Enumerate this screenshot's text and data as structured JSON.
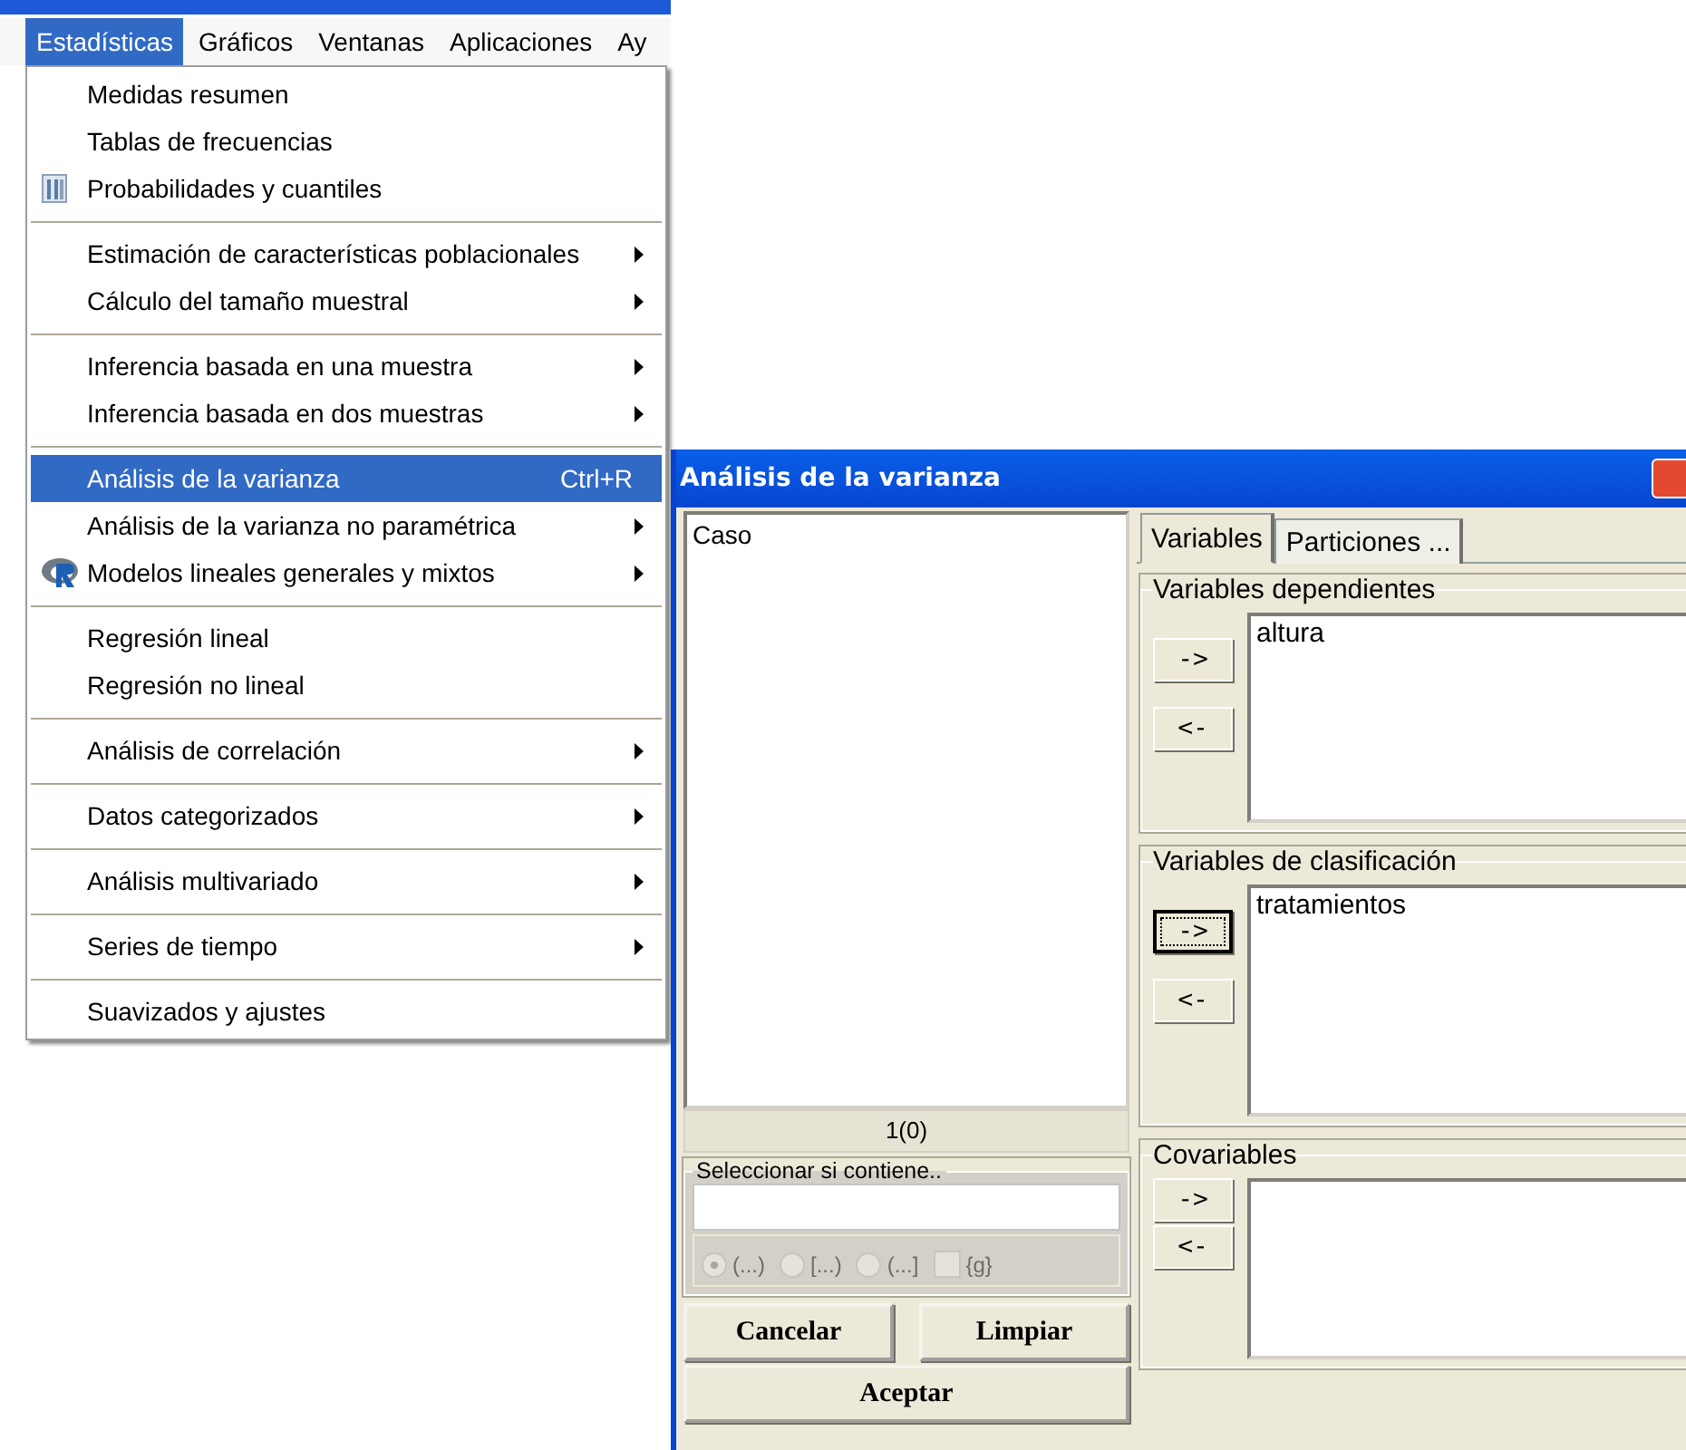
{
  "menubar": [
    {
      "label": "Estadísticas",
      "selected": true
    },
    {
      "label": "Gráficos",
      "selected": false
    },
    {
      "label": "Ventanas",
      "selected": false
    },
    {
      "label": "Aplicaciones",
      "selected": false
    },
    {
      "label": "Ay",
      "selected": false
    }
  ],
  "menu": {
    "groups": [
      [
        {
          "label": "Medidas resumen",
          "submenu": false,
          "selected": false
        },
        {
          "label": "Tablas de frecuencias",
          "submenu": false,
          "selected": false
        },
        {
          "label": "Probabilidades y cuantiles",
          "submenu": false,
          "selected": false,
          "kind": "tool"
        }
      ],
      [
        {
          "label": "Estimación de características poblacionales",
          "submenu": true,
          "selected": false
        },
        {
          "label": "Cálculo del tamaño muestral",
          "submenu": true,
          "selected": false
        }
      ],
      [
        {
          "label": "Inferencia basada en una muestra",
          "submenu": true,
          "selected": false
        },
        {
          "label": "Inferencia basada en dos muestras",
          "submenu": true,
          "selected": false
        }
      ],
      [
        {
          "label": "Análisis de la varianza",
          "submenu": false,
          "selected": true,
          "shortcut": "Ctrl+R"
        },
        {
          "label": "Análisis de la varianza no paramétrica",
          "submenu": true,
          "selected": false
        },
        {
          "label": "Modelos lineales generales y mixtos",
          "submenu": true,
          "selected": false,
          "kind": "script"
        }
      ],
      [
        {
          "label": "Regresión lineal",
          "submenu": false,
          "selected": false
        },
        {
          "label": "Regresión no lineal",
          "submenu": false,
          "selected": false
        }
      ],
      [
        {
          "label": "Análisis de correlación",
          "submenu": true,
          "selected": false
        }
      ],
      [
        {
          "label": "Datos categorizados",
          "submenu": true,
          "selected": false
        }
      ],
      [
        {
          "label": "Análisis multivariado",
          "submenu": true,
          "selected": false
        }
      ],
      [
        {
          "label": "Series de tiempo",
          "submenu": true,
          "selected": false
        }
      ],
      [
        {
          "label": "Suavizados y ajustes",
          "submenu": false,
          "selected": false
        }
      ]
    ]
  },
  "dialog": {
    "title": "Análisis de la varianza",
    "variables": [
      "Caso"
    ],
    "count": "1(0)",
    "filter": {
      "legend": "Seleccionar si contiene..",
      "disabled": true,
      "options": [
        {
          "kind": "radio",
          "label": "(...)",
          "selected": true
        },
        {
          "kind": "radio",
          "label": "[...)",
          "selected": false
        },
        {
          "kind": "radio",
          "label": "(...]",
          "selected": false
        },
        {
          "kind": "checkbox",
          "label": "{g}",
          "checked": false
        }
      ]
    },
    "buttons": {
      "cancel": "Cancelar",
      "clear": "Limpiar",
      "accept": "Aceptar"
    },
    "tabs": [
      {
        "label": "Variables",
        "selected": true
      },
      {
        "label": "Particiones ...",
        "selected": false
      }
    ],
    "groups": [
      {
        "legend": "Variables dependientes",
        "add": "->",
        "remove": "<-",
        "add_focused": false,
        "items": [
          "altura"
        ]
      },
      {
        "legend": "Variables de clasificación",
        "add": "->",
        "remove": "<-",
        "add_focused": true,
        "items": [
          "tratamientos"
        ]
      },
      {
        "legend": "Covariables",
        "add": "->",
        "remove": "<-",
        "add_focused": false
      }
    ]
  }
}
